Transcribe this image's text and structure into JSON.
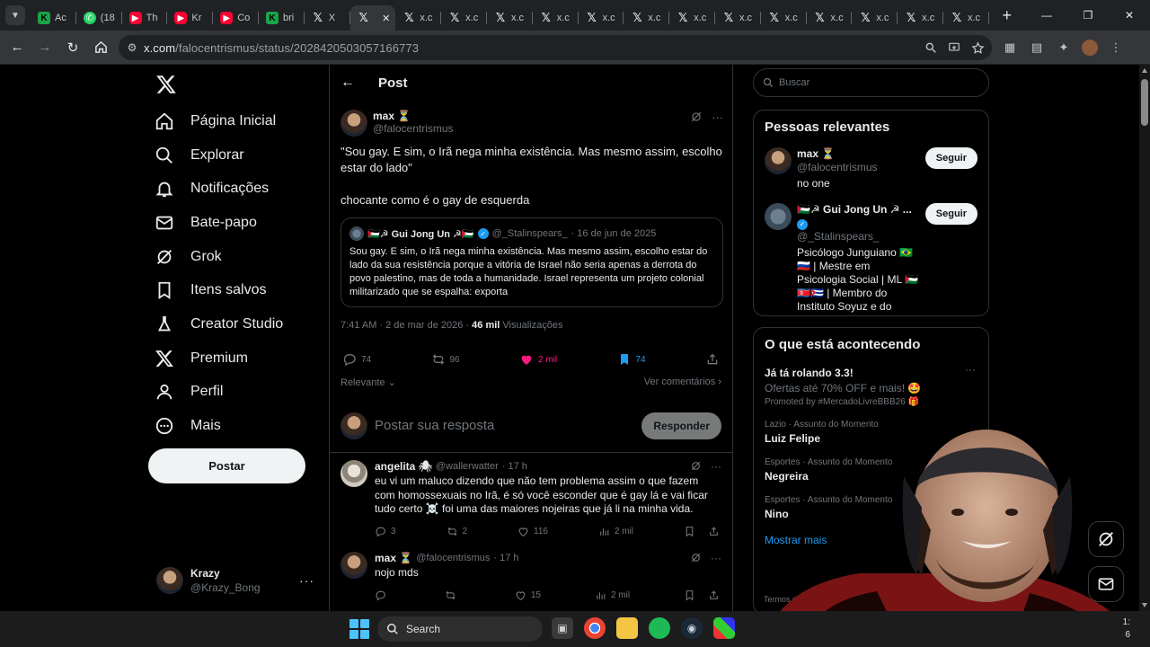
{
  "browser": {
    "tabs": [
      {
        "title": "Ac",
        "icon": "kick-icon"
      },
      {
        "title": "(18",
        "icon": "whatsapp-icon"
      },
      {
        "title": "Th",
        "icon": "youtube-icon"
      },
      {
        "title": "Kr",
        "icon": "youtube-icon"
      },
      {
        "title": "Co",
        "icon": "youtube-icon"
      },
      {
        "title": "bri",
        "icon": "kick-icon"
      },
      {
        "title": "X",
        "icon": "x-icon"
      },
      {
        "title": "",
        "icon": "x-icon",
        "active": true
      },
      {
        "title": "x.c",
        "icon": "x-icon"
      },
      {
        "title": "x.c",
        "icon": "x-icon"
      },
      {
        "title": "x.c",
        "icon": "x-icon"
      },
      {
        "title": "x.c",
        "icon": "x-icon"
      },
      {
        "title": "x.c",
        "icon": "x-icon"
      },
      {
        "title": "x.c",
        "icon": "x-icon"
      },
      {
        "title": "x.c",
        "icon": "x-icon"
      },
      {
        "title": "x.c",
        "icon": "x-icon"
      },
      {
        "title": "x.c",
        "icon": "x-icon"
      },
      {
        "title": "x.c",
        "icon": "x-icon"
      },
      {
        "title": "x.c",
        "icon": "x-icon"
      },
      {
        "title": "x.c",
        "icon": "x-icon"
      },
      {
        "title": "x.c",
        "icon": "x-icon"
      }
    ],
    "url_host": "x.com",
    "url_path": "/falocentrismus/status/2028420503057166773"
  },
  "nav": {
    "items": [
      {
        "label": "Página Inicial",
        "icon": "home-icon"
      },
      {
        "label": "Explorar",
        "icon": "search-icon"
      },
      {
        "label": "Notificações",
        "icon": "bell-icon"
      },
      {
        "label": "Bate-papo",
        "icon": "mail-icon"
      },
      {
        "label": "Grok",
        "icon": "grok-icon"
      },
      {
        "label": "Itens salvos",
        "icon": "bookmark-icon"
      },
      {
        "label": "Creator Studio",
        "icon": "flask-icon"
      },
      {
        "label": "Premium",
        "icon": "x-icon"
      },
      {
        "label": "Perfil",
        "icon": "person-icon"
      },
      {
        "label": "Mais",
        "icon": "more-circle-icon"
      }
    ],
    "post_label": "Postar",
    "me": {
      "name": "Krazy",
      "handle": "@Krazy_Bong"
    }
  },
  "header": {
    "title": "Post"
  },
  "tweet": {
    "name": "max ⏳",
    "handle": "@falocentrismus",
    "text": "\"Sou gay. E sim, o Irã nega minha existência. Mas mesmo assim, escolho estar do lado\"\n\nchocante como é o gay de esquerda",
    "quote": {
      "name": "🇵🇸☭ Gui Jong Un ☭🇵🇸",
      "handle": "@_Stalinspears_",
      "date": "· 16 de jun de 2025",
      "text": "Sou gay. E sim, o Irã nega minha existência. Mas mesmo assim, escolho estar do lado da sua resistência porque a vitória de Israel não seria apenas a derrota do povo palestino, mas de toda a humanidade. Israel representa um projeto colonial militarizado que se espalha: exporta"
    },
    "time": "7:41 AM · 2 de mar de 2026 ·",
    "views_count": "46 mil",
    "views_label": "Visualizações",
    "stats": {
      "replies": "74",
      "reposts": "96",
      "likes": "2 mil",
      "bookmarks": "74"
    },
    "sort_label": "Relevante",
    "comments_label": "Ver comentários"
  },
  "reply_box": {
    "placeholder": "Postar sua resposta",
    "button": "Responder"
  },
  "replies": [
    {
      "name": "angelita 🕷",
      "handle": "@wallerwatter",
      "time": "· 17 h",
      "text": "eu vi um maluco dizendo que não tem problema assim o que fazem com homossexuais no Irã, é só você esconder que é gay lá e vai ficar tudo certo ☠️ foi uma das maiores nojeiras que já li na minha vida.",
      "stats": {
        "replies": "3",
        "reposts": "2",
        "likes": "116",
        "views": "2 mil"
      }
    },
    {
      "name": "max ⏳",
      "handle": "@falocentrismus",
      "time": "· 17 h",
      "text": "nojo mds",
      "stats": {
        "replies": "",
        "reposts": "",
        "likes": "15",
        "views": "2 mil"
      }
    }
  ],
  "search": {
    "placeholder": "Buscar"
  },
  "relevant": {
    "title": "Pessoas relevantes",
    "people": [
      {
        "name": "max ⏳",
        "handle": "@falocentrismus",
        "bio": "no one",
        "button": "Seguir"
      },
      {
        "name": "🇵🇸☭ Gui Jong Un ☭ ...",
        "handle": "@_Stalinspears_",
        "bio": "Psicólogo Junguiano 🇧🇷🇷🇺 | Mestre em Psicologia Social | ML 🇵🇸🇰🇵🇨🇺 | Membro do Instituto Soyuz e do Comitê Rússia-Brasil de Integração. 🏳️‍🌈",
        "button": "Seguir"
      }
    ]
  },
  "trends": {
    "title": "O que está acontecendo",
    "items": [
      {
        "name": "Já tá rolando 3.3!",
        "sub": "Ofertas até 70% OFF e mais! 🤩",
        "promo": "Promoted by #MercadoLivreBBB26 🎁"
      },
      {
        "cat": "Lazio · Assunto do Momento",
        "name": "Luiz Felipe"
      },
      {
        "cat": "Esportes · Assunto do Momento",
        "name": "Negreira"
      },
      {
        "cat": "Esportes · Assunto do Momento",
        "name": "Nino"
      }
    ],
    "show_more": "Mostrar mais",
    "footer_trunc": "Termos de Se..."
  },
  "taskbar": {
    "search": "Search",
    "tray_line1": "1:",
    "tray_line2": "6"
  },
  "colors": {
    "like": "#f91880",
    "bookmark": "#1d9bf0",
    "verified": "#1d9bf0",
    "link": "#1d9bf0"
  }
}
